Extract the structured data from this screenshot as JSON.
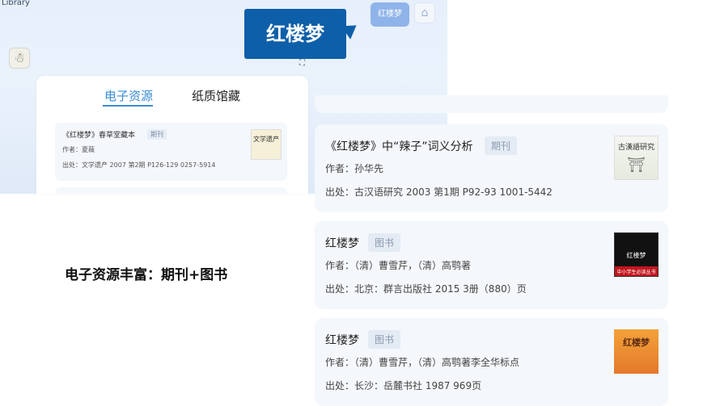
{
  "header": {
    "library_label": "Library",
    "callout_text": "红楼梦",
    "pill_button_label": "红楼梦",
    "resize_glyph": "⛶"
  },
  "tabs": [
    {
      "label": "电子资源",
      "active": true
    },
    {
      "label": "纸质馆藏",
      "active": false
    }
  ],
  "preview_record": {
    "title": "《红楼梦》春草堂藏本",
    "tag": "期刊",
    "author": "作者：夏薇",
    "source": "出处：文学遗产 2007 第2期 P126-129  0257-5914",
    "cover_text": "文学遗产"
  },
  "caption": "电子资源丰富：期刊+图书",
  "records": [
    {
      "title": "《红楼梦》中“辣子”词义分析",
      "tag": "期刊",
      "author": "作者：孙华先",
      "source": "出处：古汉语研究 2003 第1期 P92-93  1001-5442",
      "cover_text": "古漢語研究"
    },
    {
      "title": "红楼梦",
      "tag": "图书",
      "author": "作者：（清）曹雪芹，（清）高鹗著",
      "source": "出处：北京：群言出版社 2015 3册（880）页",
      "cover_text": "红楼梦",
      "cover_band": "中小学生必读丛书"
    },
    {
      "title": "红楼梦",
      "tag": "图书",
      "author": "作者：（清）曹雪芹，（清）高鹗著李全华标点",
      "source": "出处：长沙：岳麓书社 1987 969页",
      "cover_text": "红楼梦"
    }
  ],
  "colors": {
    "accent": "#3a8bd6",
    "callout_bg": "#0e5fa9",
    "card_bg": "#f4f7fb"
  },
  "icons": {
    "mascot": "mascot-icon",
    "home": "home-icon"
  }
}
